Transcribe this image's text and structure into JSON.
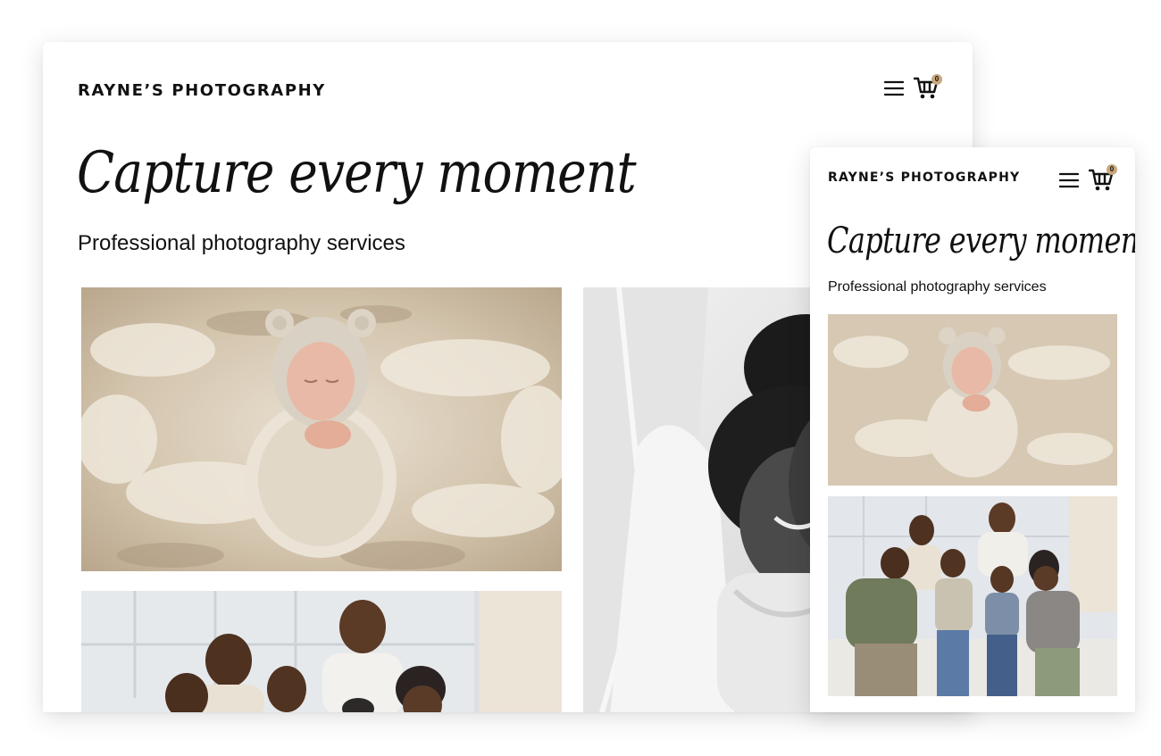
{
  "colors": {
    "text": "#111111",
    "cart_badge": "#c9a77d",
    "background": "#ffffff"
  },
  "desktop": {
    "header": {
      "brand": "RAYNE’S PHOTOGRAPHY",
      "menu_icon": "hamburger-menu-icon",
      "cart_icon": "shopping-cart-icon",
      "cart_count": "0"
    },
    "hero": {
      "headline": "Capture every moment",
      "subtitle": "Professional photography services"
    },
    "gallery": [
      {
        "subject": "newborn-photo",
        "desc": "newborn in knit bear bonnet on fur blanket"
      },
      {
        "subject": "couple-photo",
        "desc": "black and white bride and groom embrace"
      },
      {
        "subject": "family-photo",
        "desc": "multi-generation family smiling on sofa"
      }
    ]
  },
  "mobile": {
    "header": {
      "brand": "RAYNE’S PHOTOGRAPHY",
      "menu_icon": "hamburger-menu-icon",
      "cart_icon": "shopping-cart-icon",
      "cart_count": "0"
    },
    "hero": {
      "headline": "Capture every moment",
      "subtitle": "Professional photography services"
    },
    "gallery": [
      {
        "subject": "newborn-photo"
      },
      {
        "subject": "family-photo"
      }
    ]
  }
}
